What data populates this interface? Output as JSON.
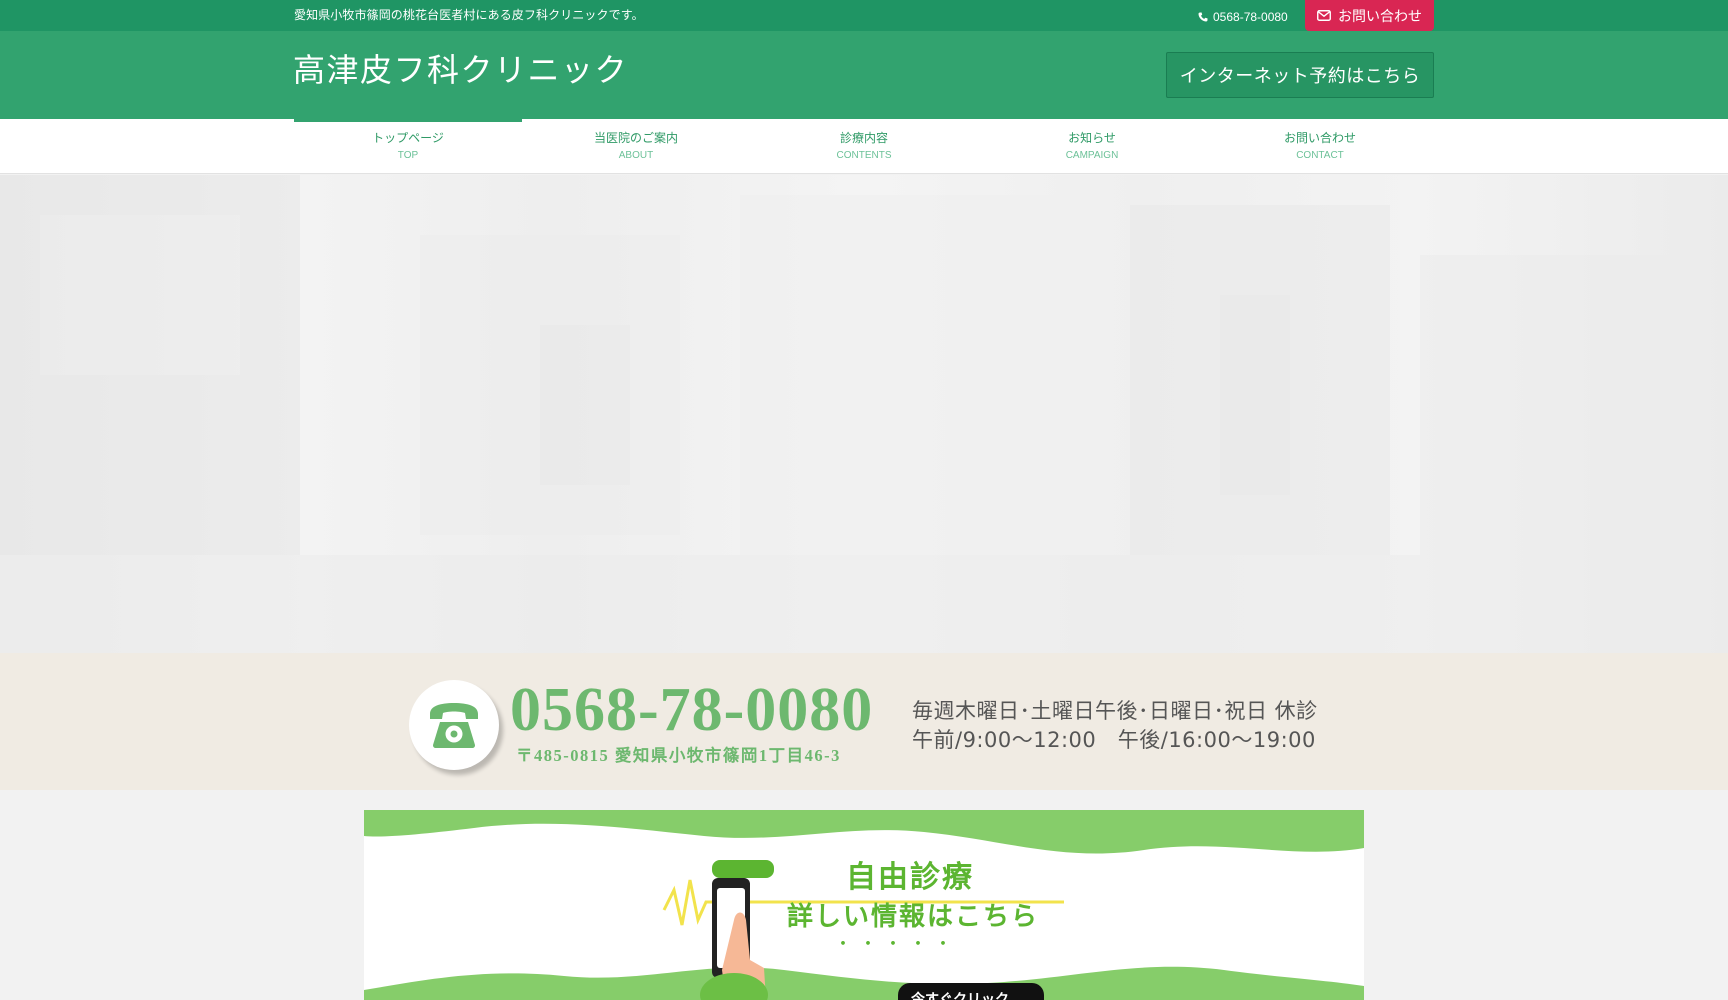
{
  "topbar": {
    "tagline": "愛知県小牧市篠岡の桃花台医者村にある皮フ科クリニックです。",
    "phone": "0568-78-0080",
    "contact_label": "お問い合わせ"
  },
  "header": {
    "logo": "高津皮フ科クリニック",
    "reserve_label": "インターネット予約はこちら"
  },
  "nav": {
    "items": [
      {
        "jp": "トップページ",
        "en": "TOP"
      },
      {
        "jp": "当医院のご案内",
        "en": "ABOUT"
      },
      {
        "jp": "診療内容",
        "en": "CONTENTS"
      },
      {
        "jp": "お知らせ",
        "en": "CAMPAIGN"
      },
      {
        "jp": "お問い合わせ",
        "en": "CONTACT"
      }
    ]
  },
  "info": {
    "phone": "0568-78-0080",
    "address": "〒485-0815 愛知県小牧市篠岡1丁目46-3",
    "closed": "毎週木曜日･土曜日午後･日曜日･祝日 休診",
    "hours": "午前/9:00～12:00　午後/16:00～19:00"
  },
  "promo": {
    "title": "自由診療",
    "subtitle": "詳しい情報はこちら",
    "dots": "・・・・・",
    "button": "今すぐクリック"
  },
  "colors": {
    "topbar": "#1f9564",
    "header": "#32a36f",
    "accent_pink": "#d92653",
    "phone_green": "#6db86f",
    "promo_green": "#5cb531"
  },
  "icons": {
    "phone": "phone-icon",
    "mail": "mail-icon",
    "telephone_circle": "telephone-icon"
  }
}
